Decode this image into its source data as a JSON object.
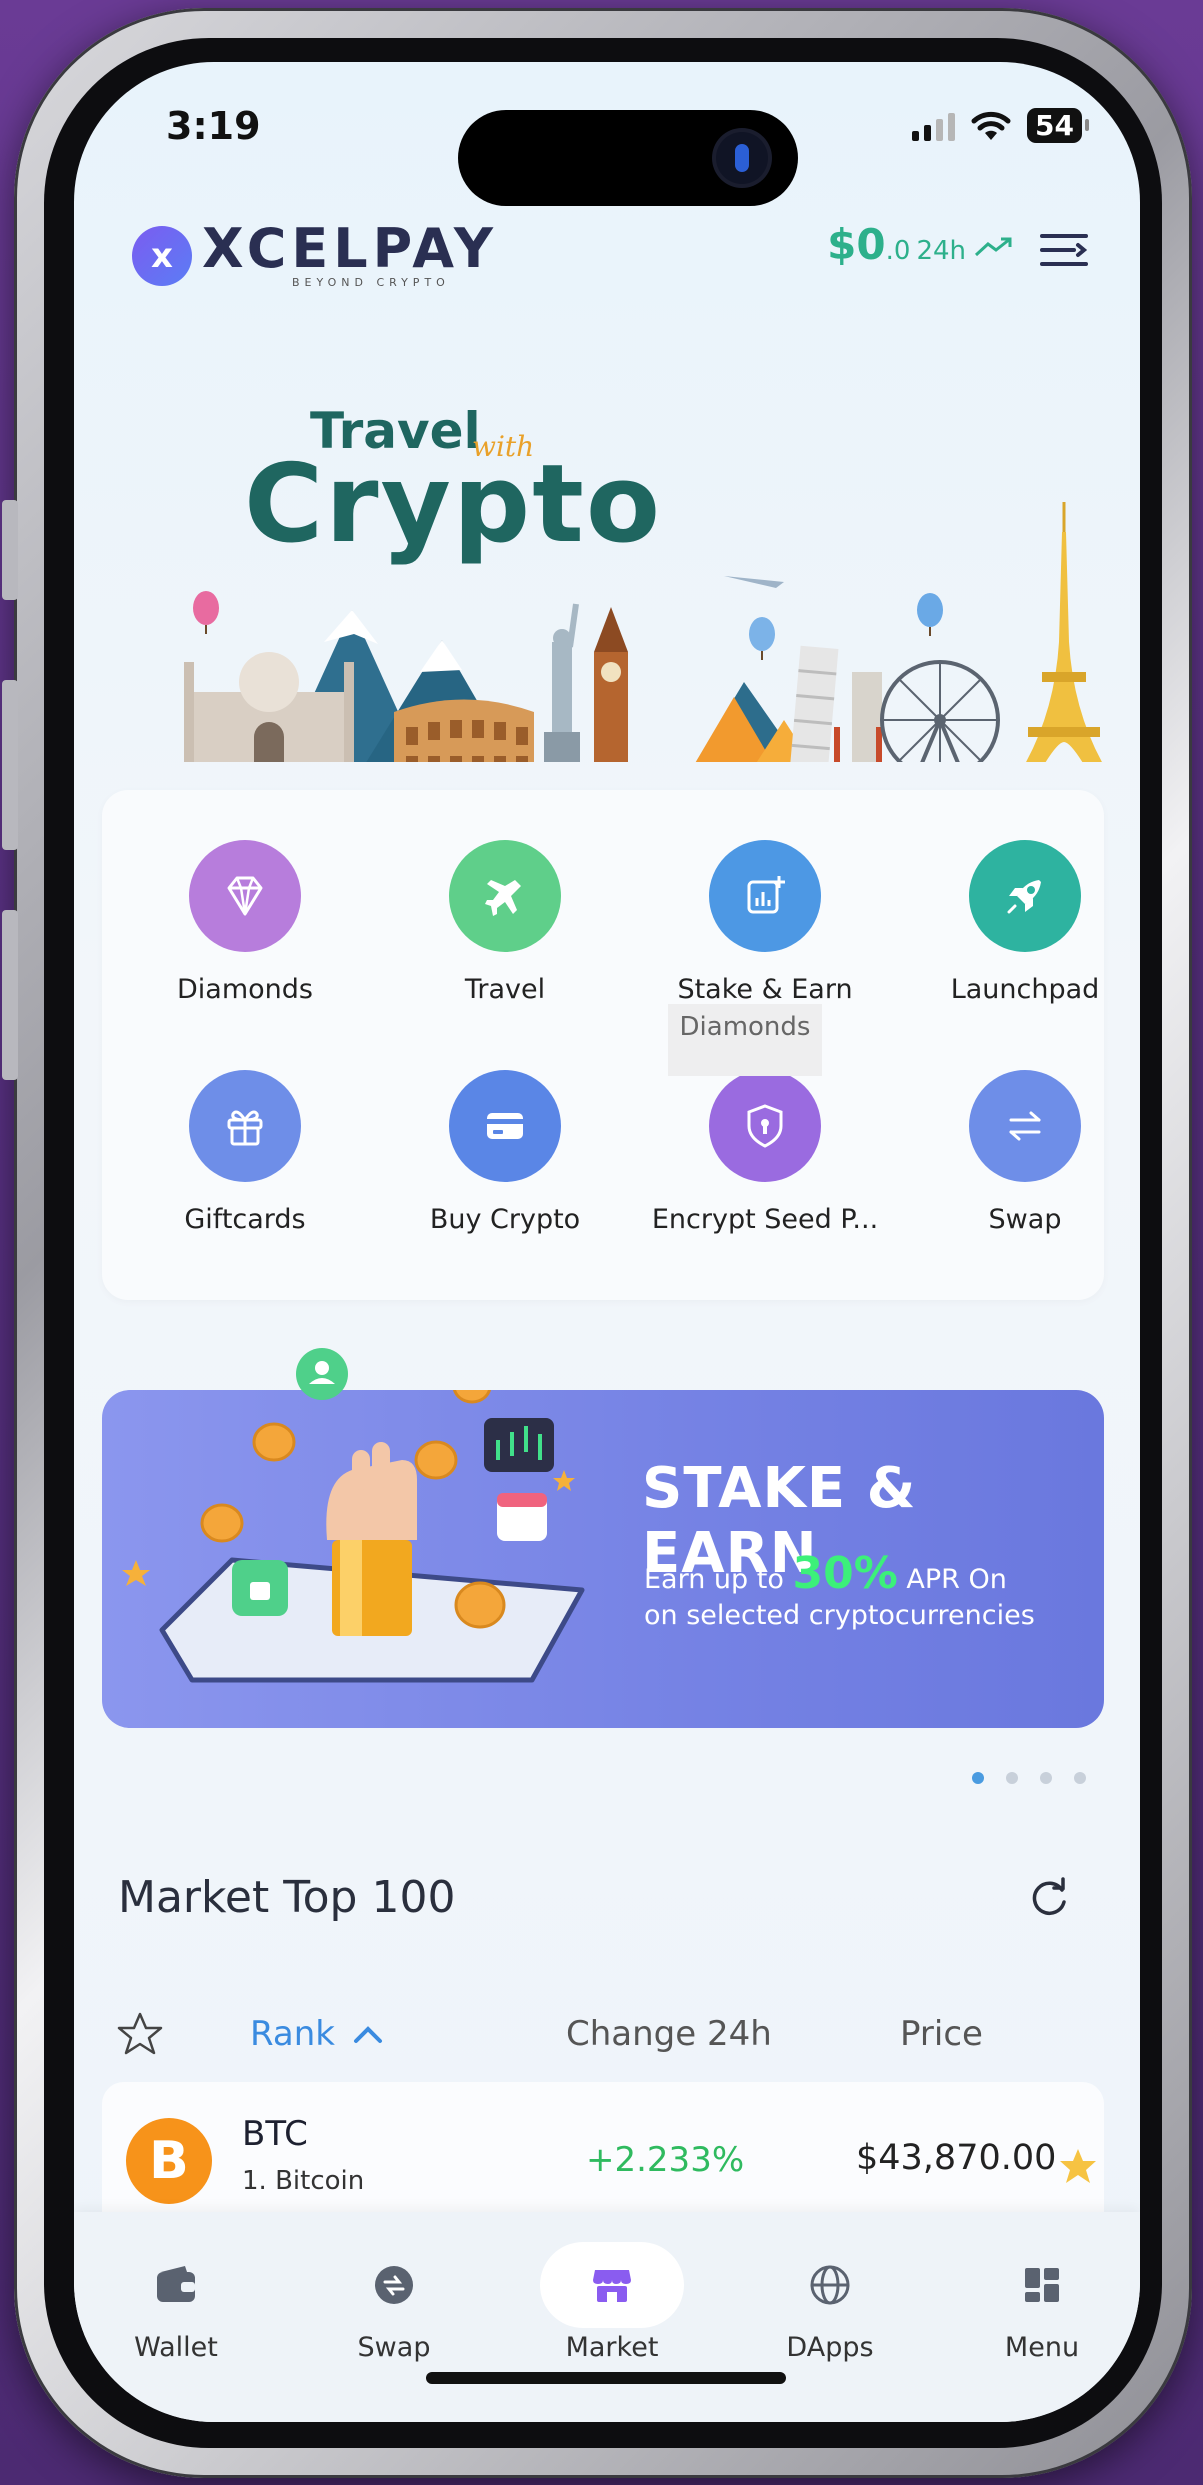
{
  "status_bar": {
    "time": "3:19",
    "battery": "54"
  },
  "header": {
    "logo_mark": "x",
    "logo_name": "XCELPAY",
    "logo_tagline": "BEYOND CRYPTO",
    "balance_amount": "$0",
    "balance_decimal": ".0",
    "balance_period": "24h",
    "trend_icon": "trend-up-icon",
    "menu_icon": "menu-icon"
  },
  "hero": {
    "title_line1": "Travel",
    "title_with": "with",
    "title_line2": "Crypto"
  },
  "actions": [
    {
      "label": "Diamonds",
      "icon": "diamond-icon",
      "color": "#b77ddc"
    },
    {
      "label": "Travel",
      "icon": "airplane-icon",
      "color": "#5fcf8a"
    },
    {
      "label": "Stake & Earn",
      "icon": "chart-plus-icon",
      "color": "#4d98e4"
    },
    {
      "label": "Launchpad",
      "icon": "rocket-icon",
      "color": "#2eb3a0"
    },
    {
      "label": "Giftcards",
      "icon": "gift-icon",
      "color": "#6e8ee8"
    },
    {
      "label": "Buy Crypto",
      "icon": "card-icon",
      "color": "#5a86e6"
    },
    {
      "label": "Encrypt Seed P...",
      "icon": "shield-icon",
      "color": "#9a6be0"
    },
    {
      "label": "Swap",
      "icon": "swap-arrows-icon",
      "color": "#6e8ee8"
    }
  ],
  "tooltip": {
    "text": "Diamonds"
  },
  "stake_banner": {
    "title": "STAKE & EARN",
    "line1_prefix": "Earn up to",
    "percent": "30%",
    "line1_suffix": "APR On",
    "line2": "on selected cryptocurrencies",
    "active_slide": 1,
    "total_slides": 4
  },
  "market": {
    "title": "Market Top 100",
    "refresh_icon": "refresh-icon",
    "columns": {
      "rank": "Rank",
      "change": "Change 24h",
      "price": "Price"
    },
    "rows": [
      {
        "logo": "B",
        "symbol": "BTC",
        "name": "1. Bitcoin",
        "change": "+2.233%",
        "price": "$43,870.00",
        "favorite": true
      }
    ]
  },
  "bottom_nav": {
    "items": [
      {
        "label": "Wallet",
        "icon": "wallet-icon",
        "active": false
      },
      {
        "label": "Swap",
        "icon": "swap-icon",
        "active": false
      },
      {
        "label": "Market",
        "icon": "store-icon",
        "active": true
      },
      {
        "label": "DApps",
        "icon": "globe-icon",
        "active": false
      },
      {
        "label": "Menu",
        "icon": "grid-icon",
        "active": false
      }
    ]
  },
  "colors": {
    "accent_green": "#2db08b",
    "rank_blue": "#3a8be0",
    "positive": "#2fba5f",
    "btc_orange": "#f7931a",
    "star_gold": "#f6c342"
  }
}
